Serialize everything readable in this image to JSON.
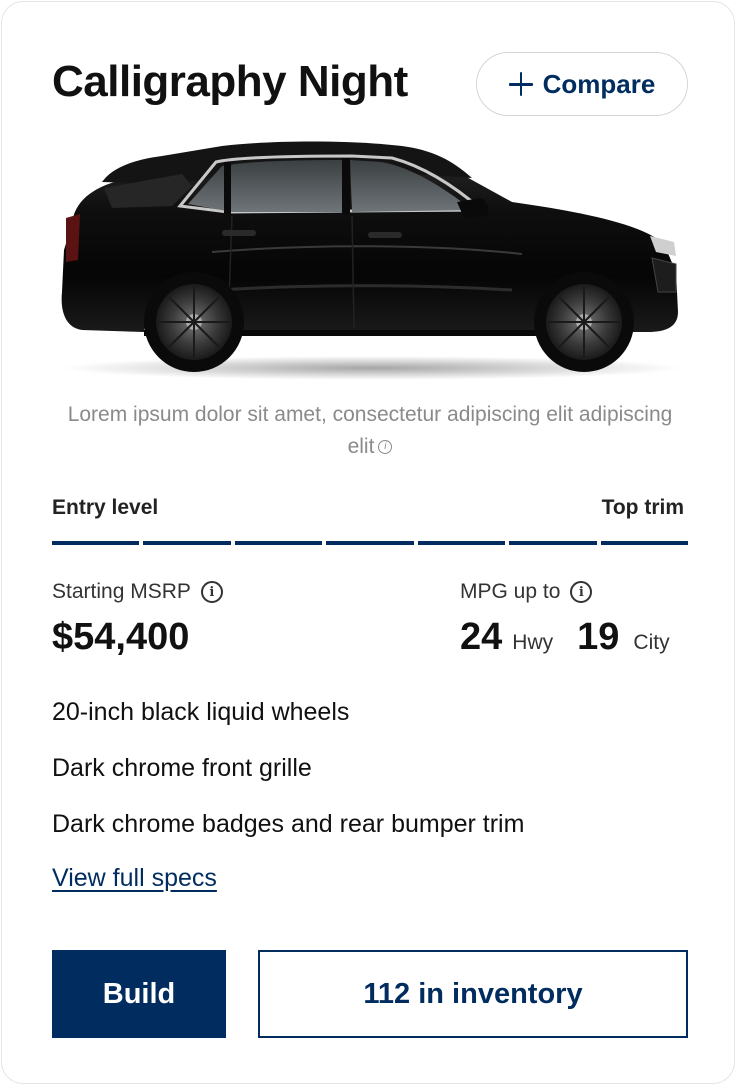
{
  "card": {
    "title": "Calligraphy Night",
    "compare_label": "Compare",
    "disclaimer": "Lorem ipsum dolor sit amet, consectetur adipiscing elit adipiscing elit",
    "trim_scale": {
      "left_label": "Entry level",
      "right_label": "Top trim",
      "segments_total": 7,
      "segments_filled": 7
    },
    "msrp": {
      "label": "Starting MSRP",
      "value": "$54,400"
    },
    "mpg": {
      "label": "MPG up to",
      "hwy_value": "24",
      "hwy_unit": "Hwy",
      "city_value": "19",
      "city_unit": "City"
    },
    "features": [
      "20-inch black liquid wheels",
      "Dark chrome front grille",
      "Dark chrome badges and rear bumper trim"
    ],
    "specs_link": "View full specs",
    "build_label": "Build",
    "inventory_label": "112 in inventory"
  },
  "colors": {
    "brand_navy": "#002c5f",
    "car_body": "#0b0b0b",
    "muted_text": "#8a8a8a"
  },
  "icons": [
    "plus-icon",
    "info-icon",
    "car-image"
  ]
}
